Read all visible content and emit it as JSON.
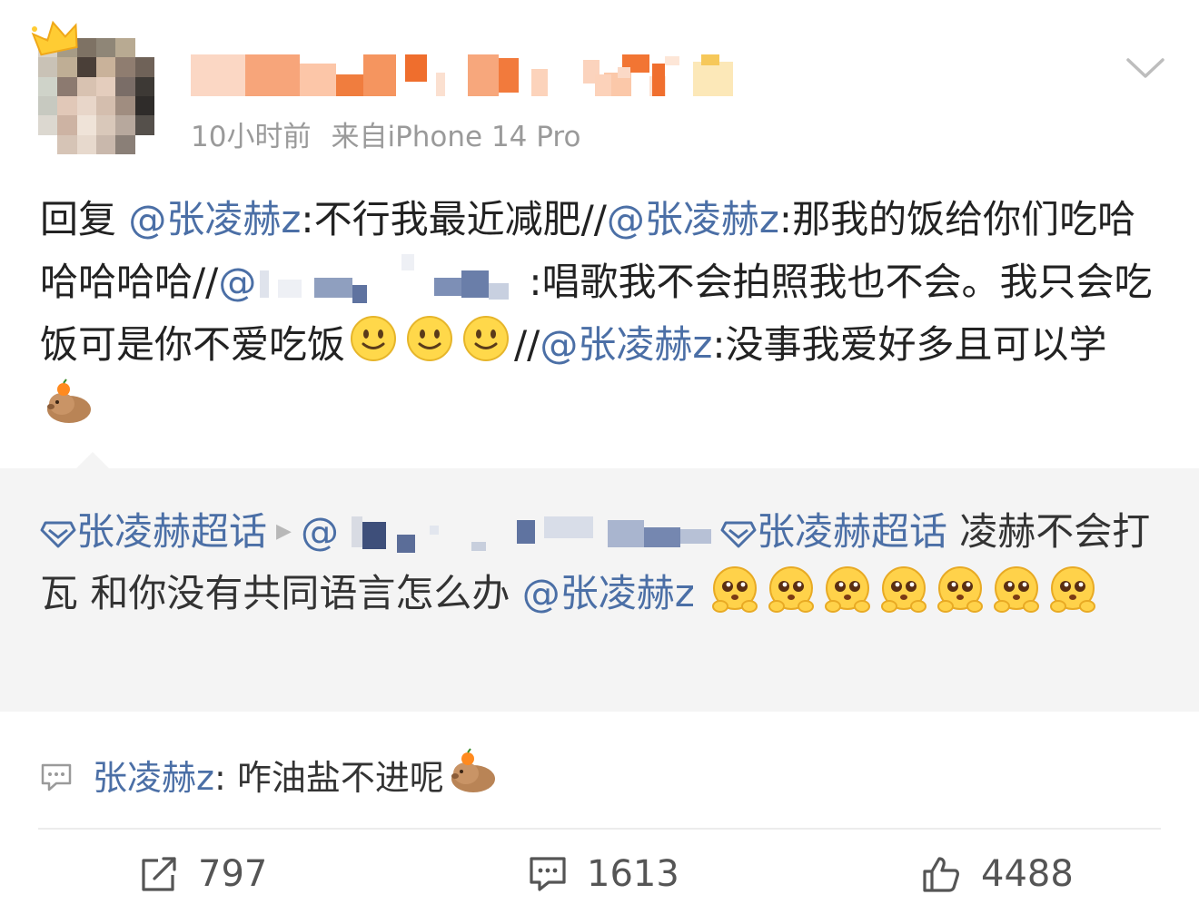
{
  "post": {
    "time": "10小时前",
    "source": "来自iPhone 14 Pro",
    "segments": {
      "reply_prefix": "回复",
      "m1": "@张凌赫z",
      "t1": ":不行我最近减肥//",
      "m2": "@张凌赫z",
      "t2": ":那我的饭给你们吃哈哈哈哈哈//",
      "m3_at": "@",
      "t3": ":唱歌我不会拍照我也不会。我只会吃饭可是你不爱吃饭",
      "t4": "//",
      "m4": "@张凌赫z",
      "t5": ":没事我爱好多且可以学"
    }
  },
  "repost": {
    "topic1": "张凌赫超话",
    "at": "@",
    "topic2": "张凌赫超话",
    "text1": " 凌赫不会打瓦 和你没有共同语言怎么办",
    "mention": "@张凌赫z"
  },
  "comment": {
    "name": "张凌赫z",
    "text": ": 咋油盐不进呢"
  },
  "actions": {
    "repost_count": "797",
    "comment_count": "1613",
    "like_count": "4488"
  },
  "colors": {
    "link": "#4b6fa6",
    "meta": "#9a9a9a",
    "repost_bg": "#f4f4f4"
  },
  "icons": [
    "crown-icon",
    "chevron-down-icon",
    "smile-emoji",
    "capybara-emoji",
    "pleading-emoji",
    "super-topic-icon",
    "comment-icon",
    "repost-icon",
    "like-icon"
  ]
}
